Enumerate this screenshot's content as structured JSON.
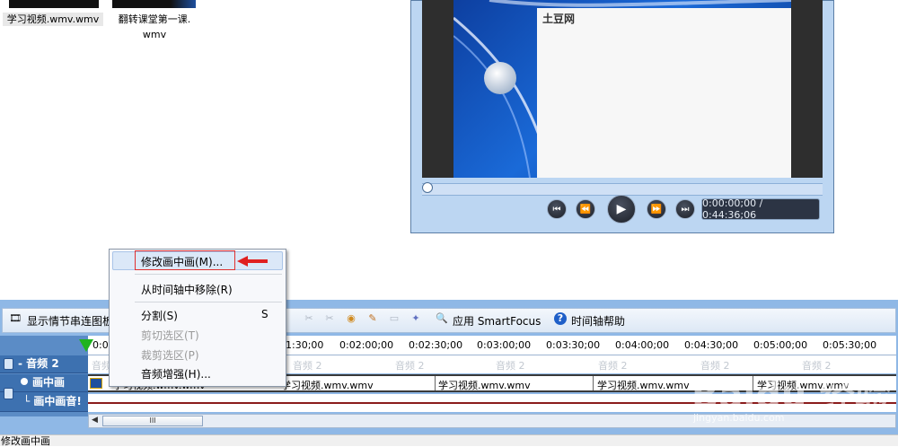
{
  "clip_bin": {
    "clips": [
      {
        "label": "学习视频.wmv.wmv"
      },
      {
        "label_line1": "翻转课堂第一课.",
        "label_line2": "wmv"
      }
    ]
  },
  "preview": {
    "slide_text": "土豆网",
    "timecode": "0:00:00;00 / 0:44:36;06",
    "seek_position": 0,
    "icons": [
      "skip-back-icon",
      "rewind-icon",
      "play-icon",
      "fast-forward-icon",
      "skip-forward-icon"
    ]
  },
  "context_menu": {
    "items": [
      {
        "label": "修改画中画(M)...",
        "enabled": true,
        "highlighted": true
      },
      {
        "label": "从时间轴中移除(R)",
        "enabled": true
      },
      {
        "label": "分割(S)",
        "shortcut": "S",
        "enabled": true
      },
      {
        "label": "剪切选区(T)",
        "enabled": false
      },
      {
        "label": "裁剪选区(P)",
        "enabled": false
      },
      {
        "label": "音频增强(H)...",
        "enabled": true
      }
    ]
  },
  "toolbar": {
    "storyboard_label": "显示情节串连图板",
    "smartfocus_label": "应用 SmartFocus",
    "help_label": "时间轴帮助"
  },
  "timeline": {
    "ruler_labels": [
      "0:00",
      "1:30;00",
      "0:02:00;00",
      "0:02:30;00",
      "0:03:00;00",
      "0:03:30;00",
      "0:04:00;00",
      "0:04:30;00",
      "0:05:00;00",
      "0:05:30;00"
    ],
    "tracks": {
      "audio2": {
        "name": "- 音频 2",
        "ghost_label": "音频 2"
      },
      "pip": {
        "name": "画中画",
        "clip_label": "学习视频.wmv.wmv"
      },
      "pip_audio": {
        "name": "└ 画中画音!"
      }
    },
    "scroll_thumb_label": "III"
  },
  "status_bar": {
    "text": "修改画中画"
  },
  "watermark": {
    "text": "Baidu 经验",
    "url": "jingyan.baidu.com"
  }
}
